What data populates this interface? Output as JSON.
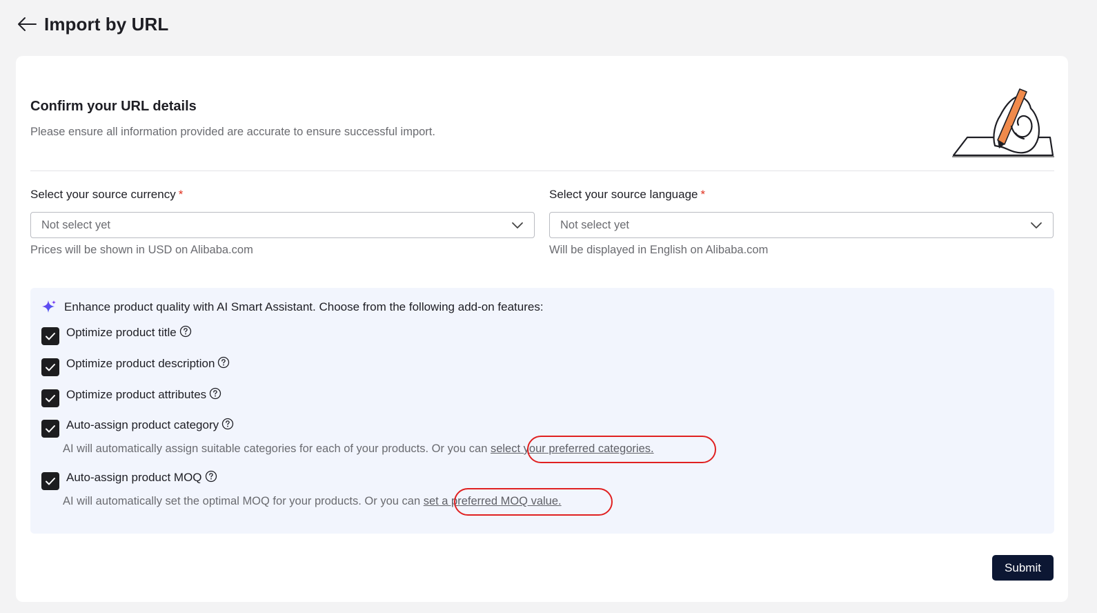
{
  "header": {
    "title": "Import by URL",
    "back_icon": "arrow-left-icon"
  },
  "section": {
    "title": "Confirm your URL details",
    "description": "Please ensure all information provided are accurate to ensure successful import."
  },
  "currency": {
    "label": "Select your source currency",
    "required_mark": "*",
    "value": "Not select yet",
    "hint": "Prices will be shown in USD on Alibaba.com"
  },
  "language": {
    "label": "Select your source language",
    "required_mark": "*",
    "value": "Not select yet",
    "hint": "Will be displayed in English on Alibaba.com"
  },
  "ai": {
    "heading": "Enhance product quality with AI Smart Assistant. Choose from the following add-on features:",
    "options": [
      {
        "label": "Optimize product title",
        "checked": true
      },
      {
        "label": "Optimize product description",
        "checked": true
      },
      {
        "label": "Optimize product attributes",
        "checked": true
      },
      {
        "label": "Auto-assign product category",
        "checked": true,
        "note": "AI will automatically assign suitable categories for each of your products. Or you can ",
        "link": "select your preferred categories."
      },
      {
        "label": "Auto-assign product MOQ",
        "checked": true,
        "note": "AI will automatically set the optimal MOQ for your products. Or you can ",
        "link": "set a preferred MOQ value."
      }
    ]
  },
  "footer": {
    "submit_label": "Submit"
  },
  "colors": {
    "accent_dark": "#0c1733",
    "required": "#e0301e",
    "ai_panel_bg": "#f2f5fd",
    "highlight": "#e02020"
  }
}
